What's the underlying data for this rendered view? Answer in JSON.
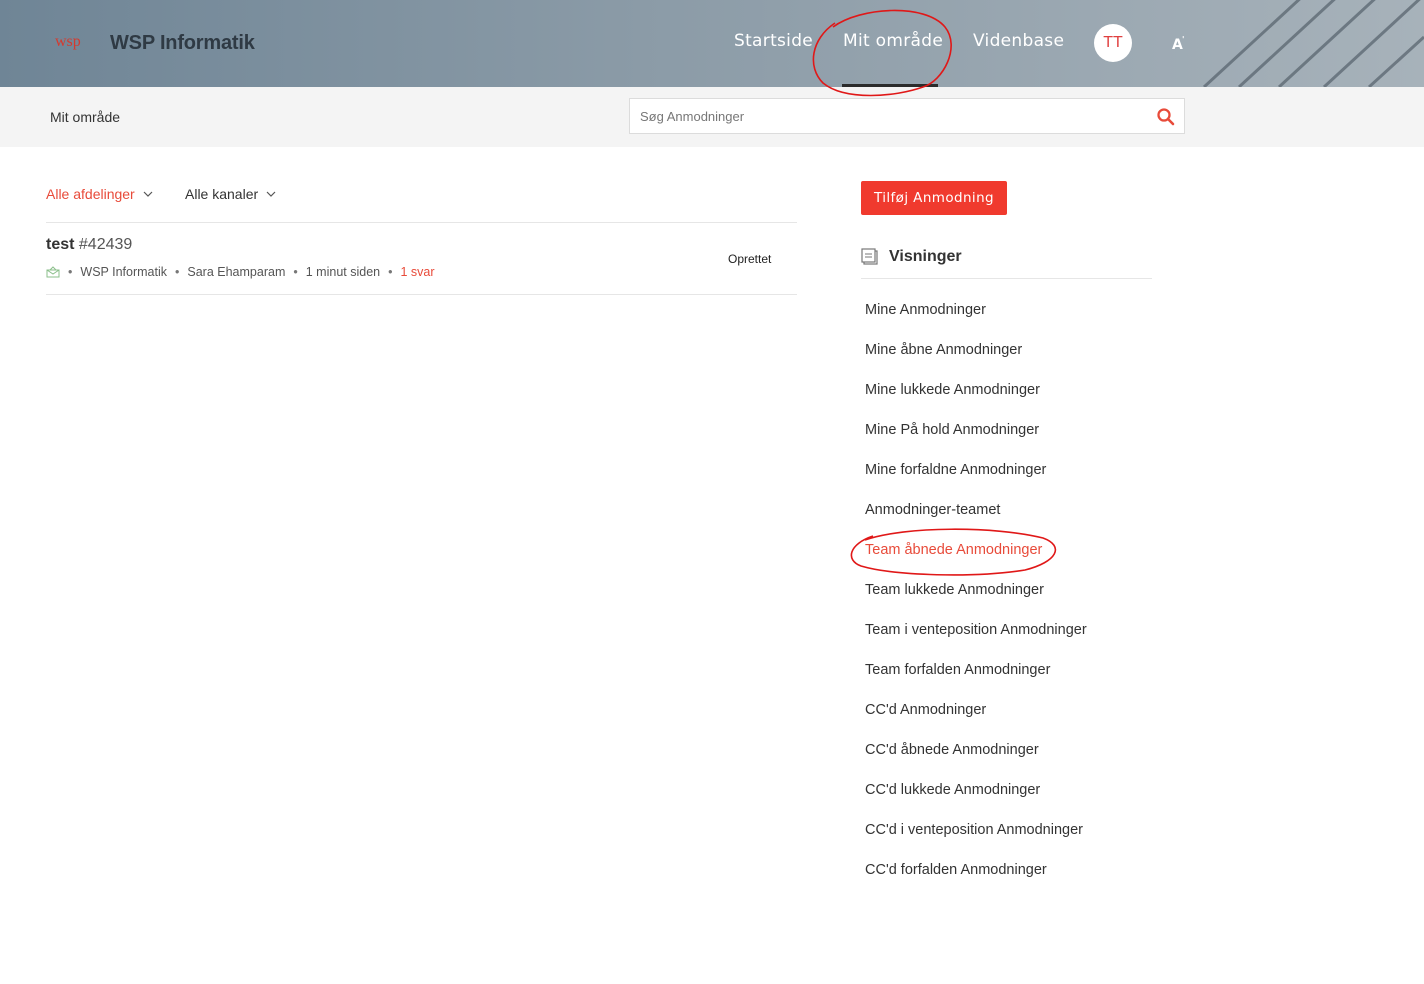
{
  "header": {
    "brand": "WSP Informatik",
    "logo_text": "wsp",
    "nav": [
      {
        "label": "Startside"
      },
      {
        "label": "Mit område",
        "active": true
      },
      {
        "label": "Videnbase"
      }
    ],
    "avatar_initials": "TT",
    "accessibility_icon": "font-size-icon"
  },
  "subbar": {
    "title": "Mit område",
    "search_placeholder": "Søg Anmodninger",
    "search_icon": "search-icon"
  },
  "filters": {
    "departments": "Alle afdelinger",
    "channels": "Alle kanaler"
  },
  "tickets": [
    {
      "subject": "test",
      "number": "#42439",
      "department": "WSP Informatik",
      "requester": "Sara Ehamparam",
      "time": "1 minut siden",
      "replies": "1 svar",
      "status": "Oprettet",
      "channel_icon": "email-icon"
    }
  ],
  "sidebar": {
    "add_button": "Tilføj Anmodning",
    "views_title": "Visninger",
    "views": [
      {
        "label": "Mine Anmodninger"
      },
      {
        "label": "Mine åbne Anmodninger"
      },
      {
        "label": "Mine lukkede Anmodninger"
      },
      {
        "label": "Mine På hold Anmodninger"
      },
      {
        "label": "Mine forfaldne Anmodninger"
      },
      {
        "label": "Anmodninger-teamet"
      },
      {
        "label": "Team åbnede Anmodninger",
        "active": true
      },
      {
        "label": "Team lukkede Anmodninger"
      },
      {
        "label": "Team i venteposition Anmodninger"
      },
      {
        "label": "Team forfalden Anmodninger"
      },
      {
        "label": "CC'd Anmodninger"
      },
      {
        "label": "CC'd åbnede Anmodninger"
      },
      {
        "label": "CC'd lukkede Anmodninger"
      },
      {
        "label": "CC'd i venteposition Anmodninger"
      },
      {
        "label": "CC'd forfalden Anmodninger"
      }
    ]
  },
  "colors": {
    "accent": "#f03a2e",
    "annotation": "#e01818"
  }
}
